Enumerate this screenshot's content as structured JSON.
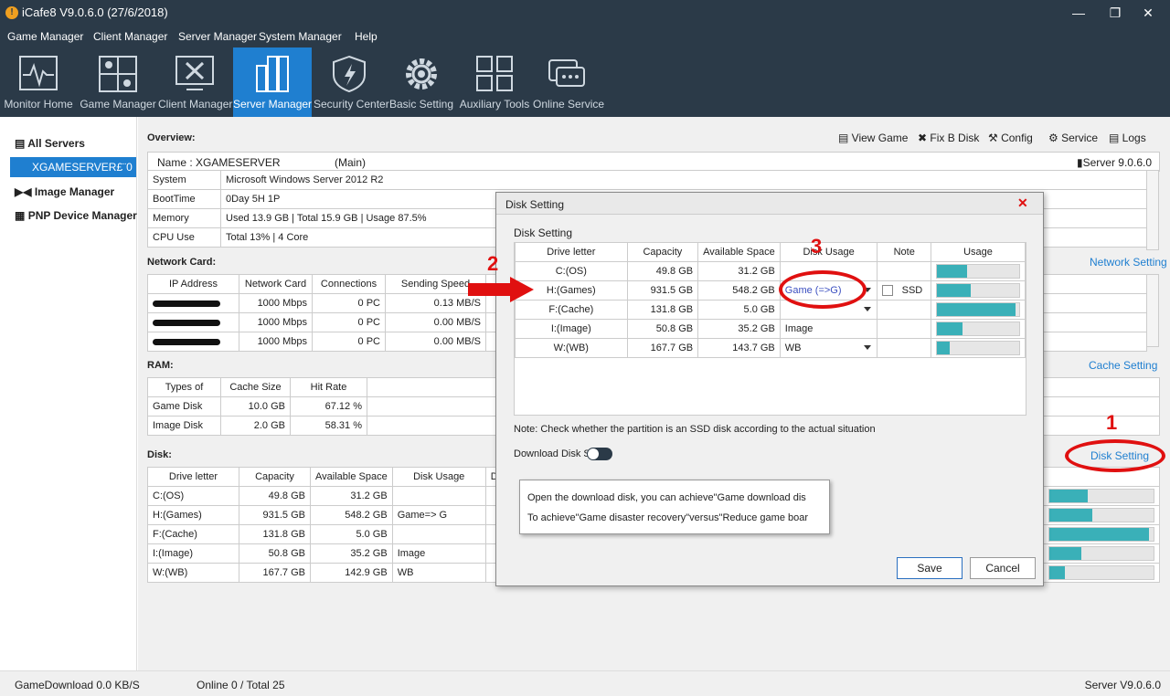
{
  "window": {
    "title": "iCafe8 V9.0.6.0 (27/6/2018)"
  },
  "menu": [
    "Game Manager",
    "Client Manager",
    "Server Manager",
    "System Manager",
    "Help"
  ],
  "toolbar": [
    {
      "label": "Monitor Home",
      "icon": "monitor-icon"
    },
    {
      "label": "Game Manager",
      "icon": "game-icon"
    },
    {
      "label": "Client Manager",
      "icon": "client-icon"
    },
    {
      "label": "Server Manager",
      "icon": "server-icon"
    },
    {
      "label": "Security Center",
      "icon": "shield-icon"
    },
    {
      "label": "Basic Setting",
      "icon": "gear-icon"
    },
    {
      "label": "Auxiliary Tools",
      "icon": "grid-icon"
    },
    {
      "label": "Online Service",
      "icon": "chat-icon"
    }
  ],
  "sidebar": {
    "all_servers": "All Servers",
    "server_node": "XGAMESERVER£¨0",
    "image_manager": "Image Manager",
    "pnp_manager": "PNP Device Manager"
  },
  "overview": {
    "title": "Overview:",
    "actions": [
      "View Game",
      "Fix B Disk",
      "Config",
      "Service",
      "Logs"
    ],
    "name_line": "Name : XGAMESERVER",
    "main_tag": "(Main)",
    "server_version": "Server  9.0.6.0",
    "rows": [
      [
        "System",
        "Microsoft Windows Server 2012 R2"
      ],
      [
        "BootTime",
        "0Day 5H 1P"
      ],
      [
        "Memory",
        "Used 13.9 GB | Total 15.9 GB | Usage  87.5%"
      ],
      [
        "CPU Use",
        "Total  13% | 4 Core"
      ]
    ]
  },
  "network": {
    "title": "Network Card:",
    "setting_link": "Network Setting",
    "headers": [
      "IP Address",
      "Network Card",
      "Connections",
      "Sending Speed"
    ],
    "rows": [
      [
        "1000 Mbps",
        "0 PC",
        "0.13 MB/S"
      ],
      [
        "1000 Mbps",
        "0 PC",
        "0.00 MB/S"
      ],
      [
        "1000 Mbps",
        "0 PC",
        "0.00 MB/S"
      ]
    ]
  },
  "ram": {
    "title": "RAM:",
    "setting_link": "Cache Setting",
    "headers": [
      "Types of",
      "Cache Size",
      "Hit Rate"
    ],
    "rows": [
      [
        "Game Disk",
        "10.0 GB",
        "67.12 %"
      ],
      [
        "Image Disk",
        "2.0 GB",
        "58.31 %"
      ]
    ]
  },
  "disk": {
    "title": "Disk:",
    "setting_link": "Disk Setting",
    "headers": [
      "Drive letter",
      "Capacity",
      "Available Space",
      "Disk Usage",
      "Dis"
    ],
    "rows": [
      [
        "C:(OS)",
        "49.8 GB",
        "31.2 GB",
        "",
        0.37
      ],
      [
        "H:(Games)",
        "931.5 GB",
        "548.2 GB",
        "Game=> G",
        0.41
      ],
      [
        "F:(Cache)",
        "131.8 GB",
        "5.0 GB",
        "",
        0.96
      ],
      [
        "I:(Image)",
        "50.8 GB",
        "35.2 GB",
        "Image",
        0.31
      ],
      [
        "W:(WB)",
        "167.7 GB",
        "142.9 GB",
        "WB",
        0.15
      ]
    ]
  },
  "dialog": {
    "title": "Disk Setting",
    "section": "Disk Setting",
    "headers": [
      "Drive letter",
      "Capacity",
      "Available Space",
      "Disk Usage",
      "Note",
      "Usage"
    ],
    "rows": [
      {
        "drive": "C:(OS)",
        "cap": "49.8 GB",
        "avail": "31.2 GB",
        "usage": "",
        "dropdown": false,
        "ssd": false,
        "fill": 0.37
      },
      {
        "drive": "H:(Games)",
        "cap": "931.5 GB",
        "avail": "548.2 GB",
        "usage": "Game (=>G)",
        "dropdown": true,
        "ssd": true,
        "fill": 0.41
      },
      {
        "drive": "F:(Cache)",
        "cap": "131.8 GB",
        "avail": "5.0 GB",
        "usage": "",
        "dropdown": true,
        "ssd": false,
        "fill": 0.96
      },
      {
        "drive": "I:(Image)",
        "cap": "50.8 GB",
        "avail": "35.2 GB",
        "usage": "Image",
        "dropdown": false,
        "ssd": false,
        "fill": 0.31
      },
      {
        "drive": "W:(WB)",
        "cap": "167.7 GB",
        "avail": "143.7 GB",
        "usage": "WB",
        "dropdown": true,
        "ssd": false,
        "fill": 0.15
      }
    ],
    "ssd_label": "SSD",
    "note": "Note: Check whether the partition is an SSD disk according to the actual situation",
    "download_disk_label": "Download Disk S",
    "save": "Save",
    "cancel": "Cancel",
    "tooltip_line1": "Open the download disk, you can achieve\"Game download dis",
    "tooltip_line2": "To achieve\"Game disaster recovery\"versus\"Reduce game boar"
  },
  "annotations": [
    "1",
    "2",
    "3"
  ],
  "status": {
    "download": "GameDownload 0.0 KB/S",
    "online": "Online  0  /  Total  25",
    "server": "Server V9.0.6.0"
  },
  "colors": {
    "header_bg": "#2b3a48",
    "accent": "#1f7fd0",
    "usage_fill": "#3ab0b8",
    "annotation": "#e01010"
  }
}
